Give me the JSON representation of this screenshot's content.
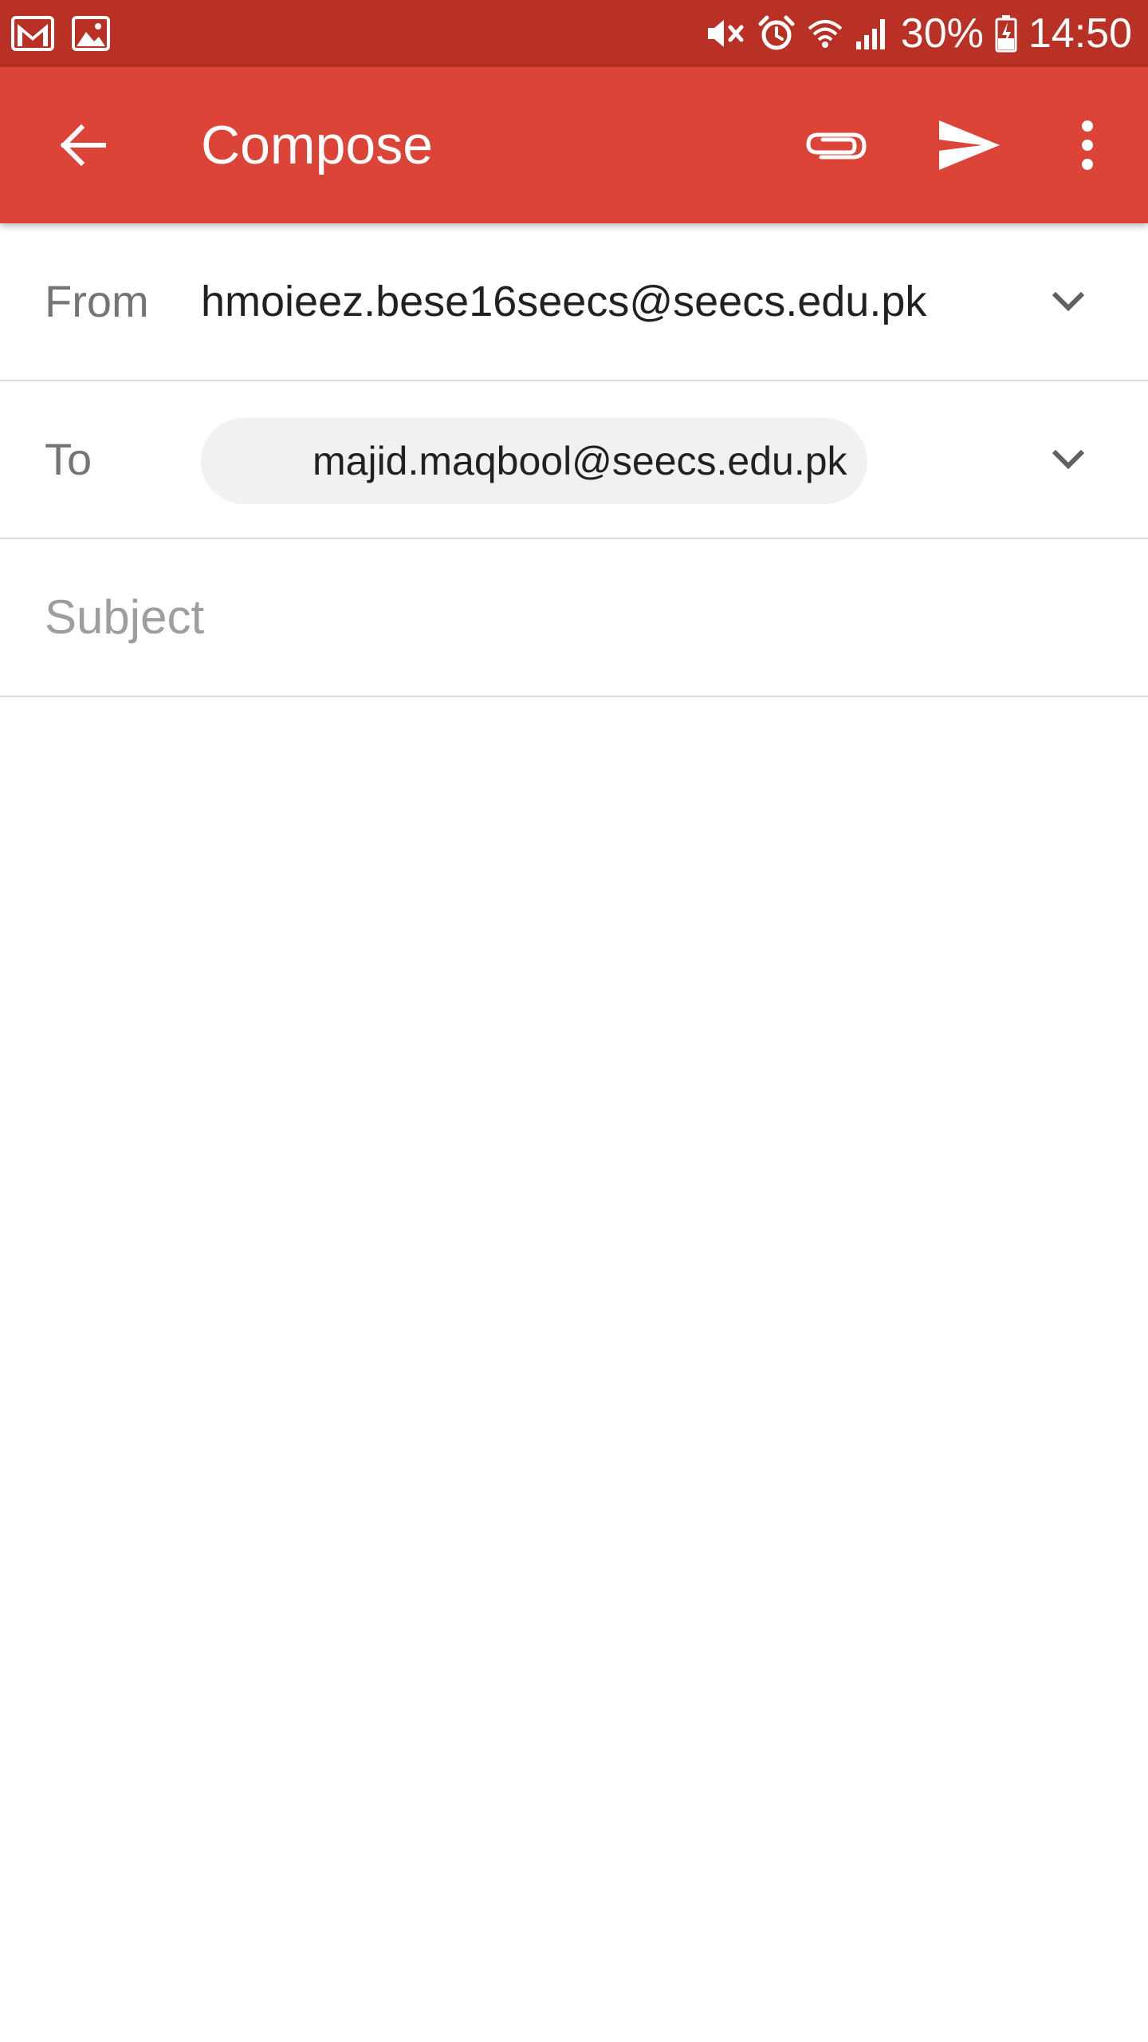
{
  "status_bar": {
    "battery": "30%",
    "time": "14:50",
    "left_icons": [
      "gmail-notification-icon",
      "gallery-notification-icon"
    ],
    "right_icons": [
      "mute-icon",
      "alarm-icon",
      "wifi-icon",
      "signal-icon",
      "battery-icon"
    ]
  },
  "app_bar": {
    "title": "Compose",
    "background": "#db4437",
    "icons": [
      "back-arrow-icon",
      "attachment-icon",
      "send-icon",
      "more-vert-icon"
    ]
  },
  "from": {
    "label": "From",
    "value": "hmoieez.bese16seecs@seecs.edu.pk"
  },
  "to": {
    "label": "To",
    "recipient": "majid.maqbool@seecs.edu.pk"
  },
  "subject": {
    "placeholder": "Subject"
  }
}
